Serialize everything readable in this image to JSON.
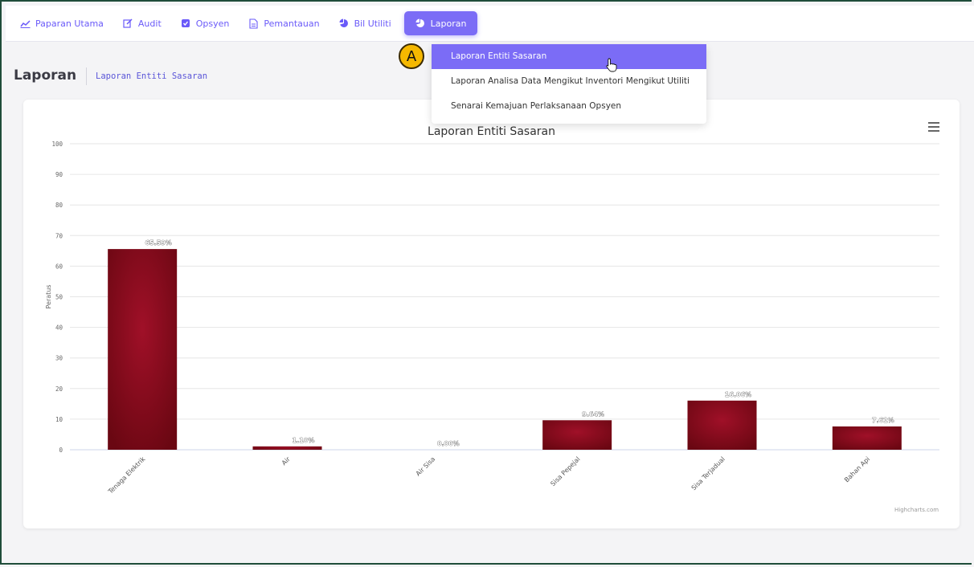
{
  "nav": {
    "items": [
      {
        "label": "Paparan Utama",
        "icon": "line-chart-icon"
      },
      {
        "label": "Audit",
        "icon": "edit-icon"
      },
      {
        "label": "Opsyen",
        "icon": "checkbox-icon"
      },
      {
        "label": "Pemantauan",
        "icon": "document-icon"
      },
      {
        "label": "Bil Utiliti",
        "icon": "pie-chart-icon"
      },
      {
        "label": "Laporan",
        "icon": "pie-chart-icon",
        "active": true
      }
    ]
  },
  "page": {
    "title": "Laporan",
    "subtitle": "Laporan Entiti Sasaran"
  },
  "dropdown": {
    "items": [
      {
        "label": "Laporan Entiti Sasaran",
        "active": true
      },
      {
        "label": "Laporan Analisa Data Mengikut Inventori Mengikut Utiliti"
      },
      {
        "label": "Senarai Kemajuan Perlaksanaan Opsyen"
      }
    ]
  },
  "annotation": {
    "marker": "A"
  },
  "credits": "Highcharts.com",
  "colors": {
    "accent": "#7b6cf6",
    "bar": "#a01028",
    "bar_dark": "#6a0712"
  },
  "chart_data": {
    "type": "bar",
    "title": "Laporan Entiti Sasaran",
    "ylabel": "Peratus",
    "xlabel": "",
    "ylim": [
      0,
      100
    ],
    "yticks": [
      0,
      10,
      20,
      30,
      40,
      50,
      60,
      70,
      80,
      90,
      100
    ],
    "categories": [
      "Tenaga Elektrik",
      "Air",
      "Air Sisa",
      "Sisa Pepejal",
      "Sisa Terjadual",
      "Bahan Api"
    ],
    "values": [
      65.59,
      1.1,
      0.0,
      9.64,
      16.06,
      7.61
    ],
    "data_labels": [
      "65.59%",
      "1.10%",
      "0.00%",
      "9.64%",
      "16.06%",
      "7.61%"
    ],
    "grid": true,
    "legend": "none"
  }
}
